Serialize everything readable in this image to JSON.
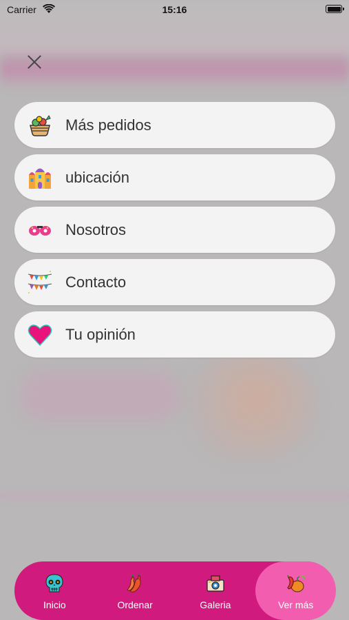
{
  "status_bar": {
    "carrier": "Carrier",
    "time": "15:16"
  },
  "menu": {
    "items": [
      {
        "label": "Más pedidos",
        "icon": "food-basket-icon"
      },
      {
        "label": "ubicación",
        "icon": "church-building-icon"
      },
      {
        "label": "Nosotros",
        "icon": "maracas-icon"
      },
      {
        "label": "Contacto",
        "icon": "papel-picado-banner-icon"
      },
      {
        "label": "Tu opinión",
        "icon": "heart-icon"
      }
    ]
  },
  "tab_bar": {
    "tabs": [
      {
        "label": "Inicio",
        "icon": "skull-icon",
        "active": false
      },
      {
        "label": "Ordenar",
        "icon": "chili-pepper-icon",
        "active": false
      },
      {
        "label": "Galeria",
        "icon": "camera-icon",
        "active": false
      },
      {
        "label": "Ver más",
        "icon": "vegetables-icon",
        "active": true
      }
    ]
  },
  "colors": {
    "tab_bar": "#d11a7e",
    "tab_active": "#f25db0",
    "menu_item_bg": "#f4f3f3"
  }
}
